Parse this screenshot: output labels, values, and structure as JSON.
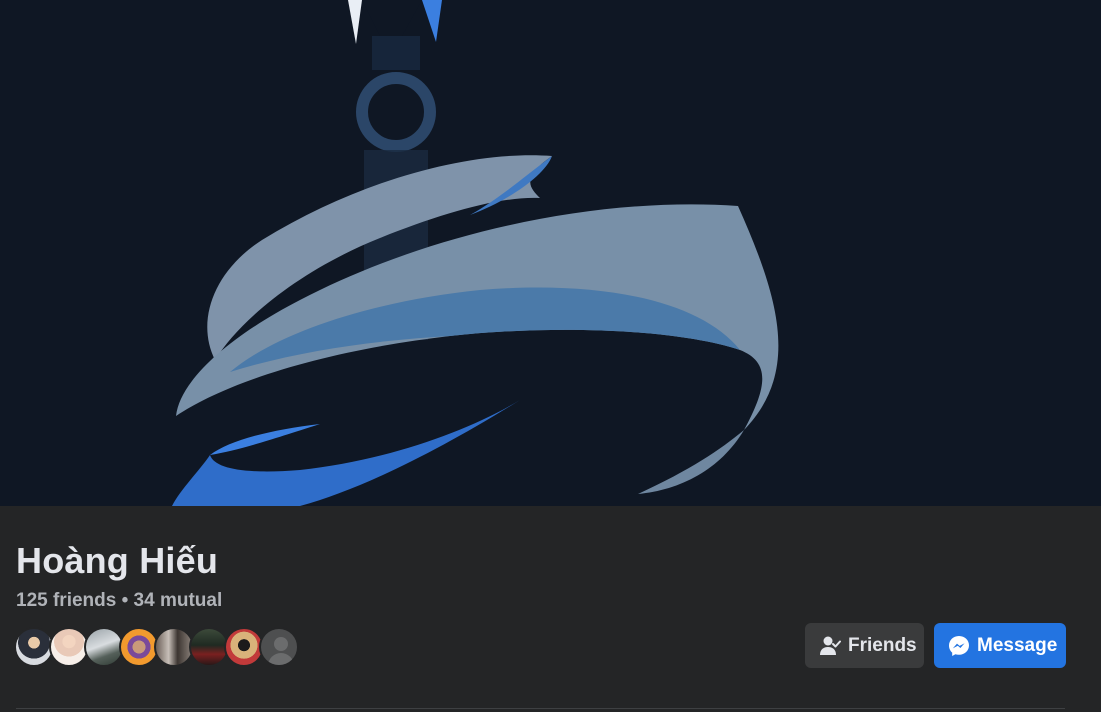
{
  "profile": {
    "name": "Hoàng Hiếu",
    "friends_summary": "125 friends • 34 mutual"
  },
  "cover": {
    "icon": "kunai-logo-icon",
    "colors": {
      "background": "#0f1724",
      "steel_light": "#7f93aa",
      "steel_blue": "#4a7db3",
      "bright_blue": "#2e6fd0"
    }
  },
  "mutual_friend_avatars": [
    "avatar-1",
    "avatar-2",
    "avatar-3",
    "avatar-4",
    "avatar-5",
    "avatar-6",
    "avatar-7",
    "avatar-8"
  ],
  "actions": {
    "friends_label": "Friends",
    "friends_icon": "user-check-icon",
    "message_label": "Message",
    "message_icon": "messenger-icon"
  },
  "colors": {
    "accent": "#2374e1",
    "surface": "#242526",
    "secondary_button": "#3a3b3c"
  }
}
